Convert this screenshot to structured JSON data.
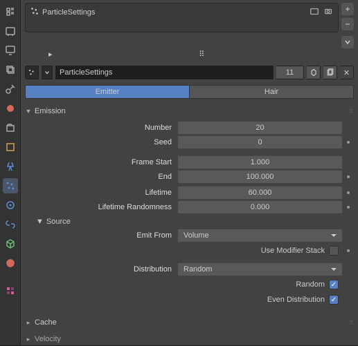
{
  "header": {
    "title": "ParticleSettings"
  },
  "datablock": {
    "name": "ParticleSettings",
    "users": "11"
  },
  "tabs": {
    "emitter": "Emitter",
    "hair": "Hair"
  },
  "panels": {
    "emission": {
      "title": "Emission",
      "number": {
        "label": "Number",
        "value": "20"
      },
      "seed": {
        "label": "Seed",
        "value": "0"
      },
      "frame_start": {
        "label": "Frame Start",
        "value": "1.000"
      },
      "frame_end": {
        "label": "End",
        "value": "100.000"
      },
      "lifetime": {
        "label": "Lifetime",
        "value": "60.000"
      },
      "lifetime_rand": {
        "label": "Lifetime Randomness",
        "value": "0.000"
      }
    },
    "source": {
      "title": "Source",
      "emit_from": {
        "label": "Emit From",
        "value": "Volume"
      },
      "use_modifier": {
        "label": "Use Modifier Stack"
      },
      "distribution": {
        "label": "Distribution",
        "value": "Random"
      },
      "random": {
        "label": "Random"
      },
      "even": {
        "label": "Even Distribution"
      }
    },
    "cache": {
      "title": "Cache"
    },
    "velocity": {
      "title": "Velocity"
    }
  }
}
